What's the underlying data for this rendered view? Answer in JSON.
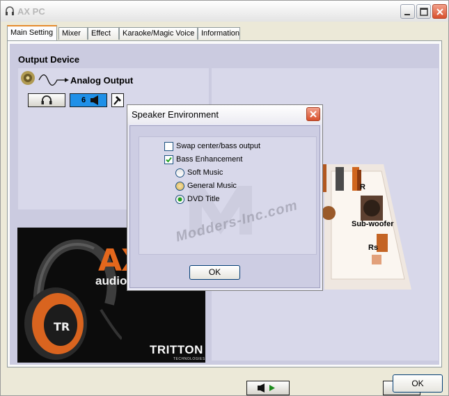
{
  "window": {
    "title": "AX PC"
  },
  "tabs": [
    {
      "label": "Main Setting",
      "active": true
    },
    {
      "label": "Mixer"
    },
    {
      "label": "Effect"
    },
    {
      "label": "Karaoke/Magic Voice"
    },
    {
      "label": "Information"
    }
  ],
  "output": {
    "section_title": "Output Device",
    "device_label": "Analog Output",
    "channel_button": "6"
  },
  "ad": {
    "headline": "AX",
    "subline": "audio",
    "brand": "TRITTON",
    "brand_sub": "TECHNOLOGIES"
  },
  "speakers": {
    "labels": {
      "right": "R",
      "subwoofer": "Sub-woofer",
      "right_surround": "Rs"
    }
  },
  "dialog": {
    "title": "Speaker Environment",
    "options": [
      {
        "label": "Swap center/bass output",
        "type": "checkbox",
        "checked": false
      },
      {
        "label": "Bass Enhancement",
        "type": "checkbox",
        "checked": true
      },
      {
        "label": "Soft Music",
        "type": "radio",
        "selected": false
      },
      {
        "label": "General Music",
        "type": "radio",
        "selected": false
      },
      {
        "label": "DVD Title",
        "type": "radio",
        "selected": true
      }
    ],
    "ok_label": "OK",
    "watermark": "Modders-Inc.com"
  },
  "footer": {
    "ok_label": "OK"
  }
}
